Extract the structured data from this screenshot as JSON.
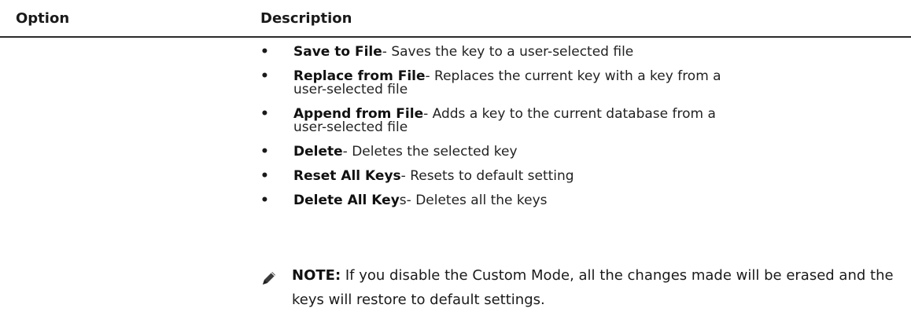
{
  "table": {
    "header": {
      "option": "Option",
      "description": "Description"
    },
    "items": [
      {
        "term": "Save to File",
        "desc": "- Saves the key to a user-selected file"
      },
      {
        "term": "Replace from File",
        "desc": "- Replaces the current key with a key from a user-selected file"
      },
      {
        "term": "Append from File",
        "desc": "- Adds a key to the current database from a user-selected file"
      },
      {
        "term": "Delete",
        "desc": "- Deletes the selected key"
      },
      {
        "term": "Reset All Keys",
        "desc": "- Resets to default setting"
      },
      {
        "term": "Delete All Key",
        "desc": "s- Deletes all the keys"
      }
    ],
    "note": {
      "label": "NOTE:",
      "text": " If you disable the Custom Mode, all the changes made will be erased and the keys will restore to default settings.",
      "icon": "pencil-icon"
    }
  }
}
